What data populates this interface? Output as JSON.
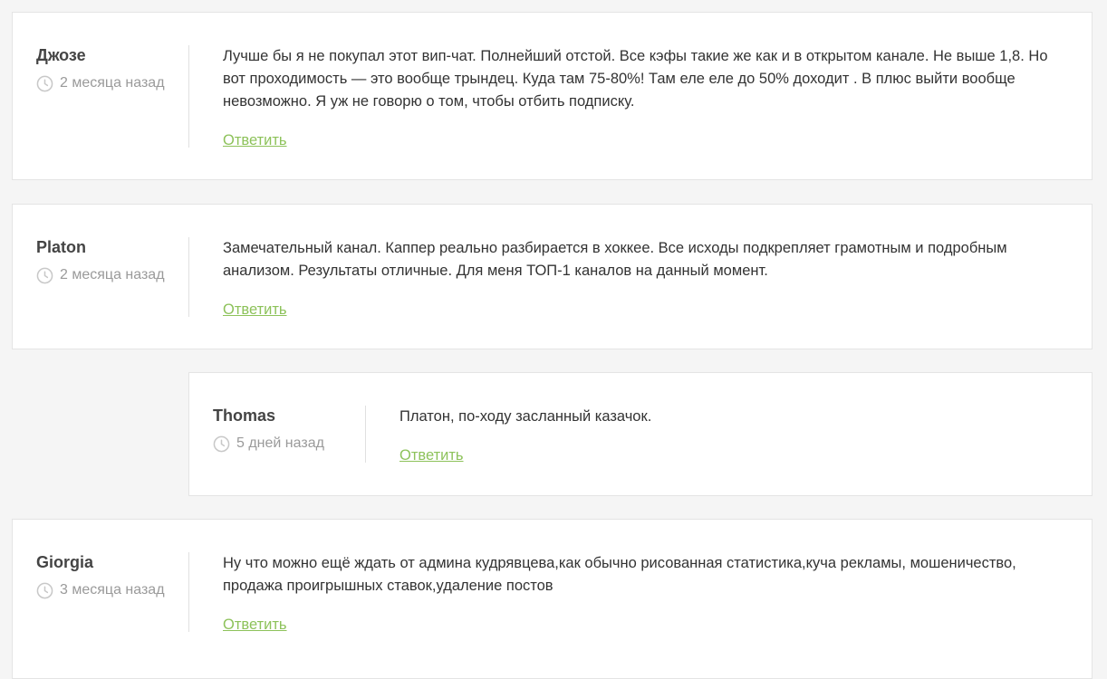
{
  "comments": [
    {
      "author": "Джозе",
      "time": "2 месяца назад",
      "text": "Лучше бы я не покупал этот вип-чат. Полнейший отстой. Все кэфы такие же как и в открытом канале. Не выше 1,8. Но вот проходимость — это вообще трындец. Куда там 75-80%! Там еле еле до 50% доходит . В плюс выйти вообще невозможно. Я уж не говорю о том, чтобы отбить подписку.",
      "reply_label": "Ответить"
    },
    {
      "author": "Platon",
      "time": "2 месяца назад",
      "text": "Замечательный канал. Каппер реально разбирается в хоккее. Все исходы подкрепляет грамотным и подробным анализом. Результаты отличные. Для меня ТОП-1 каналов на данный момент.",
      "reply_label": "Ответить"
    },
    {
      "author": "Thomas",
      "time": "5 дней назад",
      "text": "Платон, по-ходу засланный казачок.",
      "reply_label": "Ответить"
    },
    {
      "author": "Giorgia",
      "time": "3 месяца назад",
      "text": "Ну что можно ещё ждать от админа кудрявцева,как обычно рисованная статистика,куча рекламы, мошеничество, продажа проигрышных ставок,удаление постов",
      "reply_label": "Ответить"
    }
  ],
  "icons": {
    "time": "clock-icon"
  },
  "colors": {
    "background": "#f5f5f5",
    "card": "#ffffff",
    "link": "#8dc25a",
    "muted": "#9a9a9a",
    "author": "#444444"
  }
}
